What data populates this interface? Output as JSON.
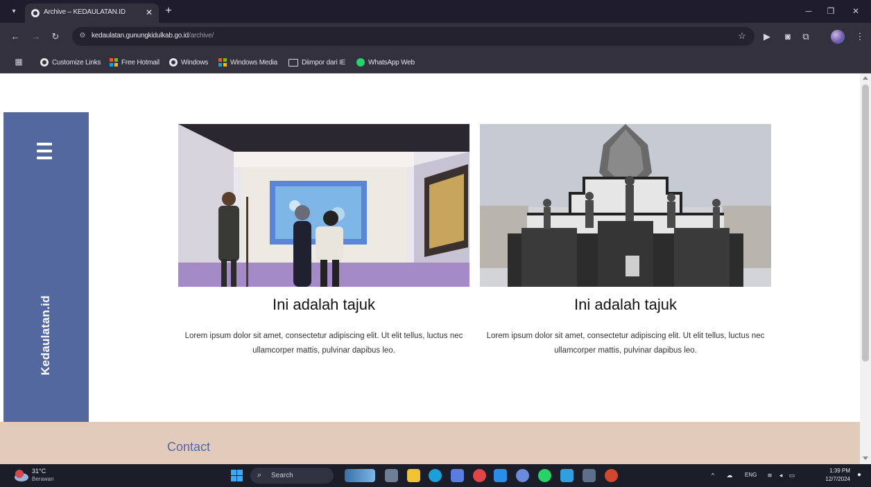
{
  "browser": {
    "tab_title": "Archive – KEDAULATAN.ID",
    "url_host": "kedaulatan.gunungkidulkab.go.id",
    "url_path": "/archive/",
    "bookmarks": [
      {
        "label": "Customize Links",
        "icon": "chrome-icon"
      },
      {
        "label": "Free Hotmail",
        "icon": "microsoft-icon"
      },
      {
        "label": "Windows",
        "icon": "chrome-icon"
      },
      {
        "label": "Windows Media",
        "icon": "microsoft-icon"
      },
      {
        "label": "Diimpor dari IE",
        "icon": "folder-icon"
      },
      {
        "label": "WhatsApp Web",
        "icon": "whatsapp-icon"
      }
    ]
  },
  "site": {
    "brand": "Kedaulatan.id",
    "accent_color": "#5468a0",
    "footer_color": "#e3cbbb",
    "cards": [
      {
        "image_alt": "museum diorama with visitors",
        "title": "Ini adalah tajuk",
        "text": "Lorem ipsum dolor sit amet, consectetur adipiscing elit. Ut elit tellus, luctus nec ullamcorper mattis, pulvinar dapibus leo."
      },
      {
        "image_alt": "monument with soldier statues",
        "title": "Ini adalah tajuk",
        "text": "Lorem ipsum dolor sit amet, consectetur adipiscing elit. Ut elit tellus, luctus nec ullamcorper mattis, pulvinar dapibus leo."
      }
    ],
    "footer_heading": "Contact"
  },
  "taskbar": {
    "temperature": "31°C",
    "weather": "Berawan",
    "search_label": "Search",
    "language": "ENG",
    "time": "1:39 PM",
    "date": "12/7/2024"
  }
}
